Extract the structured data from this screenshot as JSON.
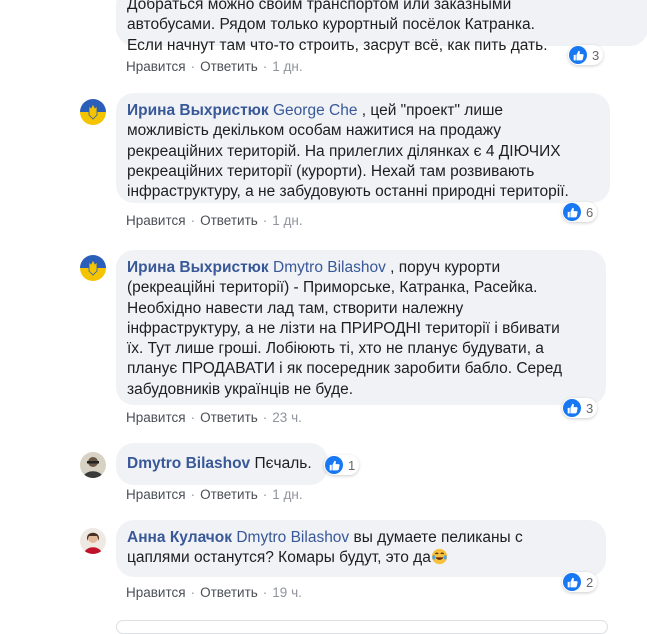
{
  "comments": [
    {
      "author": "",
      "mention": "",
      "lines": [
        "Добраться можно своим транспортом или заказными",
        "автобусами. Рядом только курортный посёлок Катранка.",
        "Если начнут там что-то строить, засрут всё, как пить дать."
      ],
      "reactions": "3",
      "like_label": "Нравится",
      "reply_label": "Ответить",
      "time": "1 дн."
    },
    {
      "author": "Ирина Выхристюк",
      "mention": "George Che",
      "lines": [
        " , цей \"проект\" лише",
        "можливість декільком особам нажитися на продажу",
        "рекреаційних територій. На прилеглих ділянках є 4 ДІЮЧИХ",
        "рекреаційних території (курорти). Нехай там розвивають",
        "інфраструктуру, а не забудовують останні природні території."
      ],
      "reactions": "6",
      "like_label": "Нравится",
      "reply_label": "Ответить",
      "time": "1 дн."
    },
    {
      "author": "Ирина Выхристюк",
      "mention": "Dmytro Bilashov",
      "lines": [
        " , поруч курорти",
        "(рекреаційні території) - Приморське, Катранка, Расейка.",
        "Необхідно навести лад там, створити належну",
        "інфраструктуру, а не лізти на ПРИРОДНІ території і вбивати",
        "їх. Тут лише гроші. Лобіюють ті, хто не планує будувати, а",
        "планує ПРОДАВАТИ і як посередник заробити бабло. Серед",
        "забудовників українців не буде."
      ],
      "reactions": "3",
      "like_label": "Нравится",
      "reply_label": "Ответить",
      "time": "23 ч."
    },
    {
      "author": "Dmytro Bilashov",
      "mention": "",
      "lines": [
        " Пєчаль."
      ],
      "reactions": "1",
      "like_label": "Нравится",
      "reply_label": "Ответить",
      "time": "1 дн."
    },
    {
      "author": "Анна Кулачок",
      "mention": "Dmytro Bilashov",
      "lines": [
        " вы думаете пеликаны с",
        "цаплями останутся? Комары будут, это да"
      ],
      "reactions": "2",
      "like_label": "Нравится",
      "reply_label": "Ответить",
      "time": "19 ч."
    }
  ],
  "icons": {
    "like_badge": "thumbs-up-icon",
    "emoji": "laughing-tears-emoji",
    "avatar_flag": "ukraine-trident-avatar",
    "avatar_person": "user-photo-avatar"
  },
  "colors": {
    "link": "#385898",
    "bubble": "#f0f2f5",
    "like_blue": "#1877f2",
    "flag_blue": "#2b5eb8",
    "flag_yellow": "#f5c400"
  }
}
